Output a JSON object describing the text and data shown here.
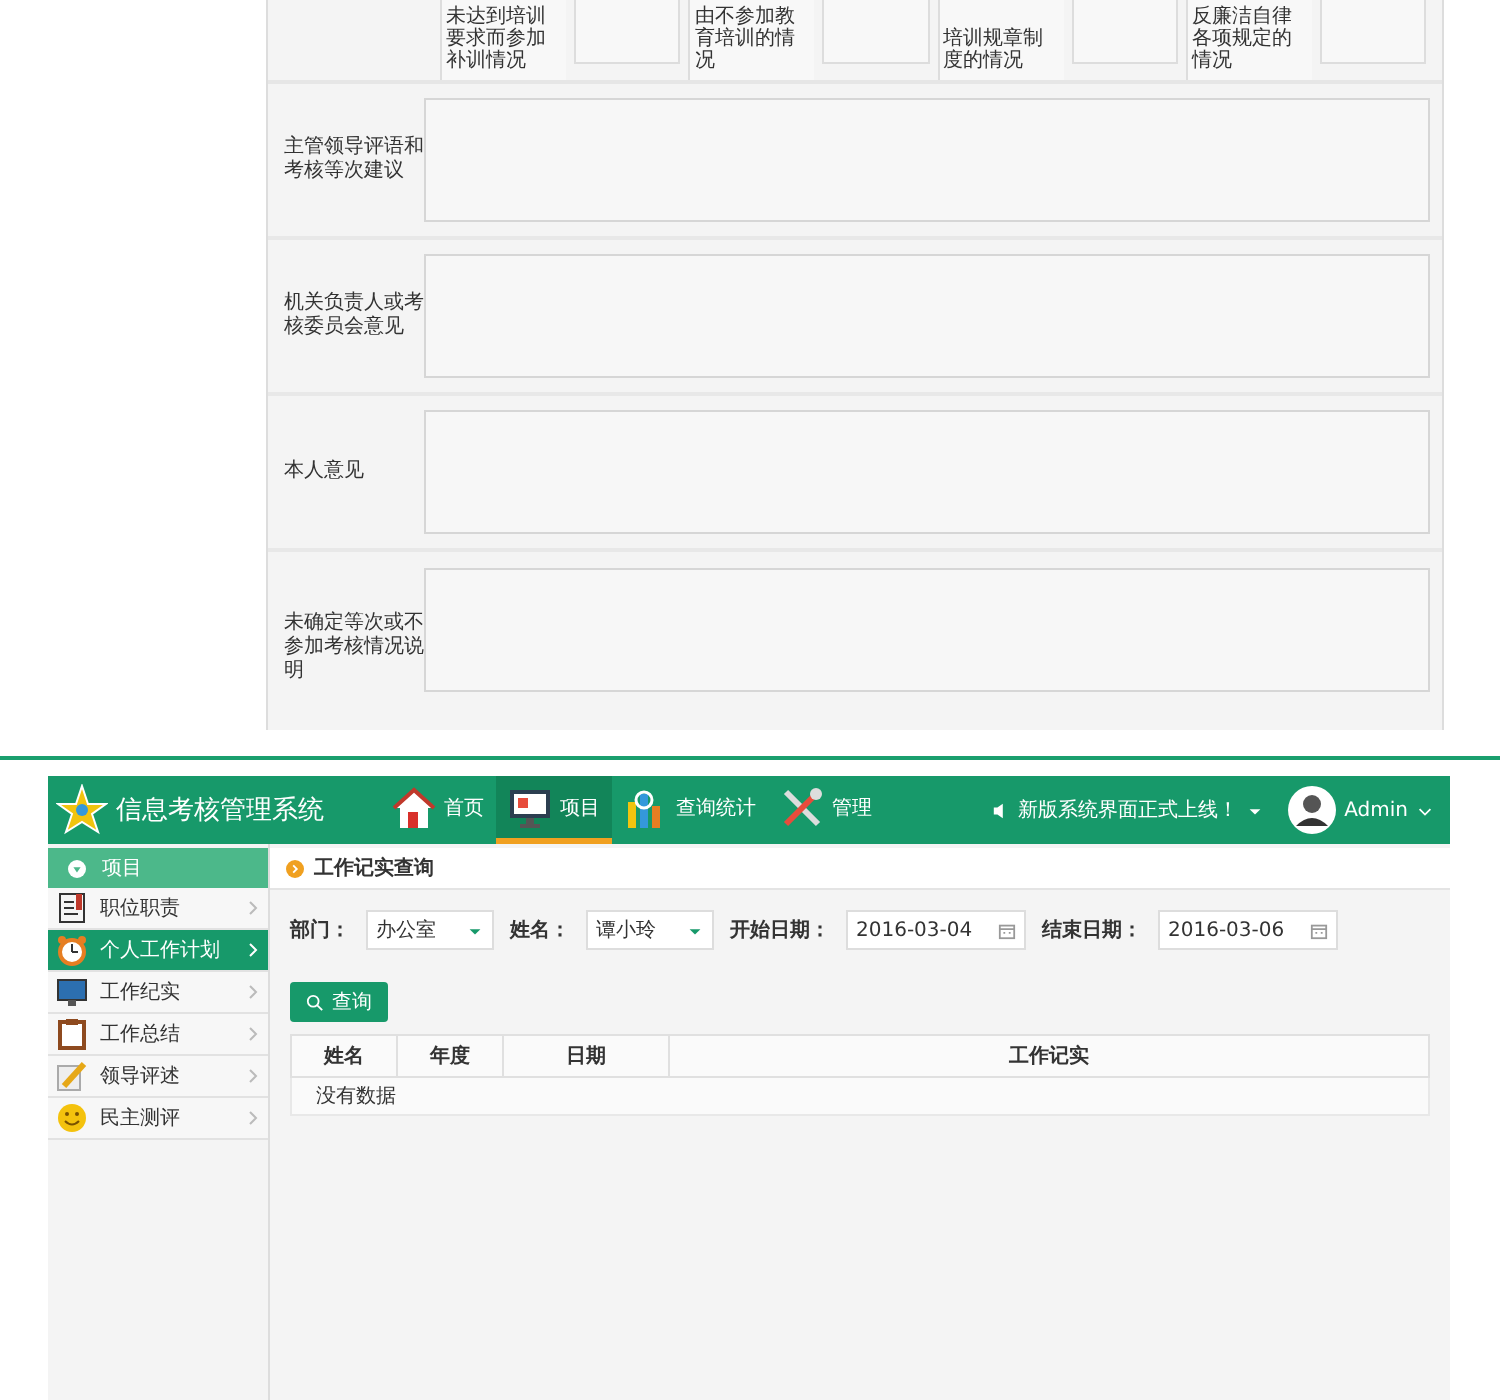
{
  "form": {
    "top_row": [
      {
        "label": "未达到培训要求而参加补训情况"
      },
      {
        "label": "由不参加教育培训的情况"
      },
      {
        "label": "培训规章制度的情况"
      },
      {
        "label": "反廉洁自律各项规定的情况"
      }
    ],
    "rows": [
      {
        "label": "主管领导评语和考核等次建议"
      },
      {
        "label": "机关负责人或考核委员会意见"
      },
      {
        "label": "本人意见"
      },
      {
        "label": "未确定等次或不参加考核情况说明"
      }
    ]
  },
  "app": {
    "title": "信息考核管理系统",
    "nav": [
      {
        "label": "首页",
        "kind": "house",
        "selected": false
      },
      {
        "label": "项目",
        "kind": "monitor",
        "selected": true
      },
      {
        "label": "查询统计",
        "kind": "chart",
        "selected": false
      },
      {
        "label": "管理",
        "kind": "tools",
        "selected": false
      }
    ],
    "notice": "新版系统界面正式上线！",
    "user": "Admin",
    "sidebar": {
      "header": "项目",
      "items": [
        {
          "label": "职位职责",
          "kind": "book",
          "selected": false
        },
        {
          "label": "个人工作计划",
          "kind": "clock",
          "selected": true
        },
        {
          "label": "工作纪实",
          "kind": "monitor",
          "selected": false
        },
        {
          "label": "工作总结",
          "kind": "clipboard",
          "selected": false
        },
        {
          "label": "领导评述",
          "kind": "pencil",
          "selected": false
        },
        {
          "label": "民主测评",
          "kind": "smiley",
          "selected": false
        }
      ]
    },
    "panel_title": "工作记实查询",
    "filters": [
      {
        "label": "部门：",
        "kind": "select",
        "value": "办公室"
      },
      {
        "label": "姓名：",
        "kind": "select",
        "value": "谭小玲"
      },
      {
        "label": "开始日期：",
        "kind": "date",
        "value": "2016-03-04"
      },
      {
        "label": "结束日期：",
        "kind": "date",
        "value": "2016-03-06"
      }
    ],
    "search_button": "查询",
    "table": {
      "columns": [
        "姓名",
        "年度",
        "日期",
        "工作记实"
      ],
      "empty": "没有数据"
    }
  }
}
